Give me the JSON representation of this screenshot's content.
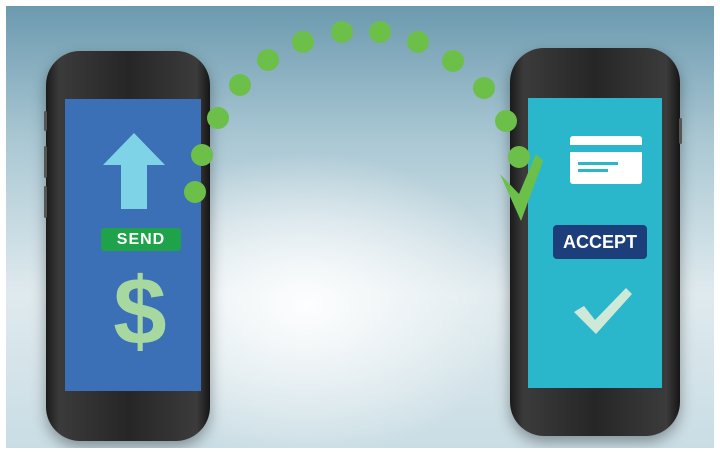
{
  "send_screen": {
    "badge_label": "SEND",
    "symbol": "$",
    "icon": "arrow-up-icon",
    "colors": {
      "screen": "#3b6fb6",
      "arrow": "#7fd3e6",
      "badge": "#1ea34b",
      "symbol": "#a6d8a0"
    }
  },
  "accept_screen": {
    "badge_label": "ACCEPT",
    "icons": [
      "credit-card-icon",
      "checkmark-icon"
    ],
    "colors": {
      "screen": "#2ab7cc",
      "badge": "#1c3e7a",
      "check": "#cfe9d9"
    }
  },
  "transfer": {
    "icon": "dotted-arc-icon",
    "dot_color": "#6cc04a"
  }
}
